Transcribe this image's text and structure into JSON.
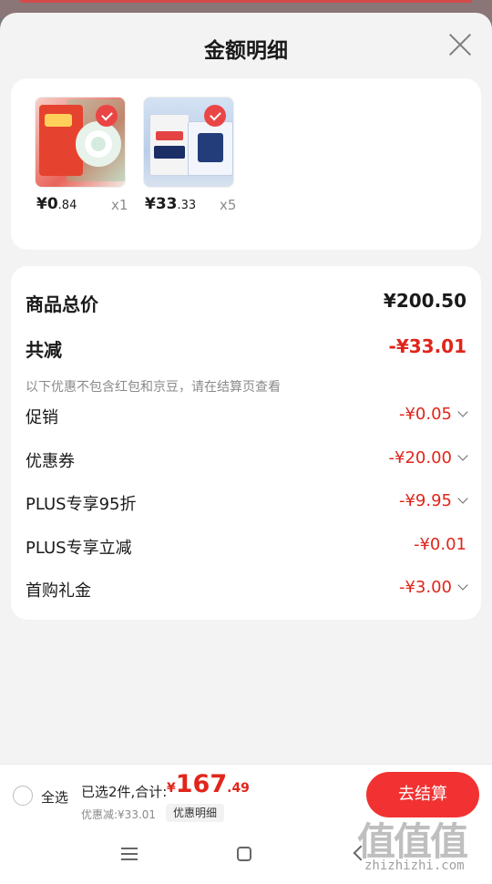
{
  "header": {
    "title": "金额明细"
  },
  "products": [
    {
      "price_int": "¥0",
      "price_dec": ".84",
      "qty": "x1"
    },
    {
      "price_int": "¥33",
      "price_dec": ".33",
      "qty": "x5"
    }
  ],
  "summary": {
    "total_label": "商品总价",
    "total_value": "¥200.50",
    "reduce_label": "共减",
    "reduce_value": "-¥33.01",
    "note": "以下优惠不包含红包和京豆，请在结算页查看",
    "items": [
      {
        "label": "促销",
        "value": "-¥0.05"
      },
      {
        "label": "优惠券",
        "value": "-¥20.00"
      },
      {
        "label": "PLUS专享95折",
        "value": "-¥9.95"
      },
      {
        "label": "PLUS专享立减",
        "value": "-¥0.01"
      },
      {
        "label": "首购礼金",
        "value": "-¥3.00"
      }
    ]
  },
  "bottom_bar": {
    "select_all": "全选",
    "selected_text": "已选2件,合计:",
    "total_currency": "¥",
    "total_int": "167",
    "total_dec": ".49",
    "saved_text": "优惠减:¥33.01",
    "detail_label": "优惠明细",
    "checkout_label": "去结算"
  },
  "watermark": {
    "glyphs": "值值值",
    "url": "zhizhizhi.com"
  },
  "colors": {
    "accent_red": "#e1251b",
    "button_red": "#f23232"
  },
  "icons": [
    "close-icon",
    "check-icon",
    "chevron-down-icon",
    "menu-icon",
    "home-icon",
    "back-icon"
  ]
}
